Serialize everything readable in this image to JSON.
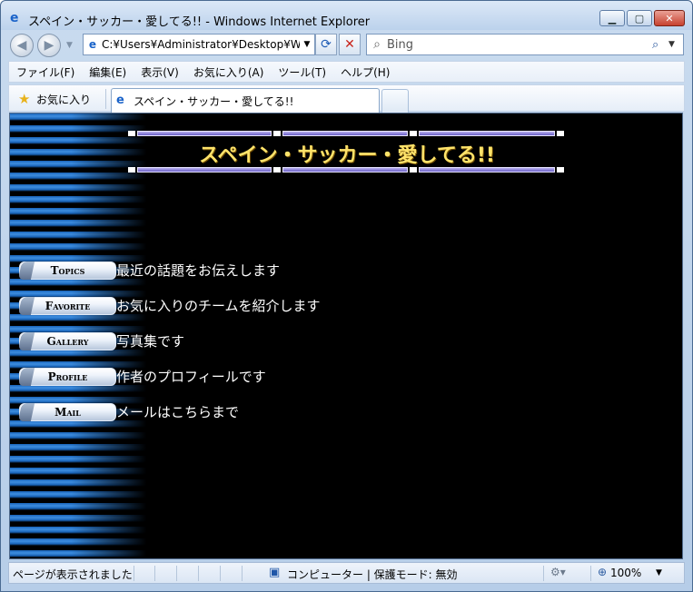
{
  "window": {
    "title": "スペイン・サッカー・愛してる!! - Windows Internet Explorer",
    "minimize": "▁",
    "maximize": "▢",
    "close": "✕"
  },
  "nav": {
    "back_glyph": "◀",
    "forward_glyph": "▶",
    "dropdown_glyph": "▼",
    "address_value": "C:¥Users¥Administrator¥Desktop¥W",
    "refresh_glyph": "⟳",
    "stop_glyph": "✕",
    "search_placeholder": "Bing",
    "search_go_glyph": "⌕"
  },
  "menubar": {
    "items": [
      "ファイル(F)",
      "編集(E)",
      "表示(V)",
      "お気に入り(A)",
      "ツール(T)",
      "ヘルプ(H)"
    ]
  },
  "favorites": {
    "label": "お気に入り",
    "tab_title": "スペイン・サッカー・愛してる!!"
  },
  "page": {
    "title": "スペイン・サッカー・愛してる!!",
    "menu": [
      {
        "label": "Topics",
        "desc": "最近の話題をお伝えします"
      },
      {
        "label": "Favorite",
        "desc": "お気に入りのチームを紹介します"
      },
      {
        "label": "Gallery",
        "desc": "写真集です"
      },
      {
        "label": "Profile",
        "desc": "作者のプロフィールです"
      },
      {
        "label": "Mail",
        "desc": "メールはこちらまで"
      }
    ]
  },
  "status": {
    "text": "ページが表示されました",
    "zone": "コンピューター | 保護モード: 無効",
    "zoom": "100%"
  },
  "colors": {
    "title_yellow": "#ffe36a",
    "stripe_blue": "#1863b8",
    "bar_purple": "#6b60c7"
  }
}
